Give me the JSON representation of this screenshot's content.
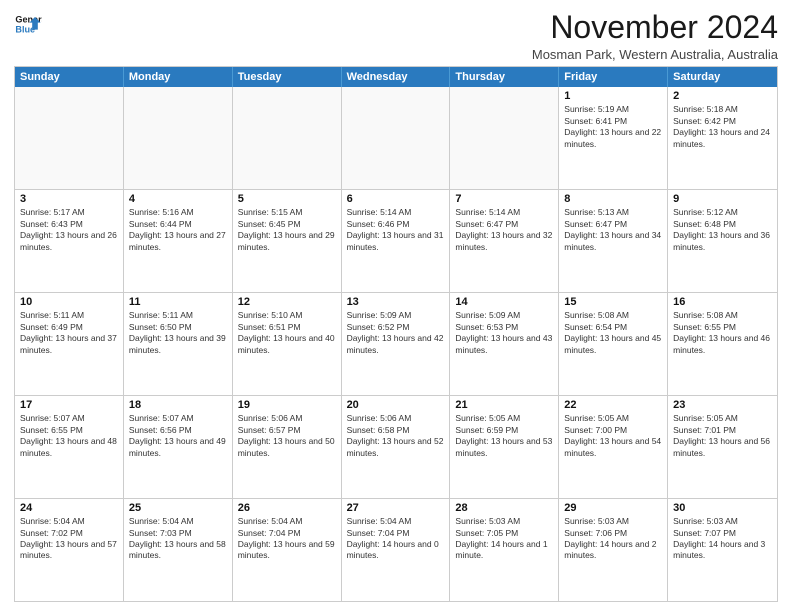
{
  "header": {
    "logo_line1": "General",
    "logo_line2": "Blue",
    "month_title": "November 2024",
    "subtitle": "Mosman Park, Western Australia, Australia"
  },
  "weekdays": [
    "Sunday",
    "Monday",
    "Tuesday",
    "Wednesday",
    "Thursday",
    "Friday",
    "Saturday"
  ],
  "rows": [
    [
      {
        "day": "",
        "empty": true
      },
      {
        "day": "",
        "empty": true
      },
      {
        "day": "",
        "empty": true
      },
      {
        "day": "",
        "empty": true
      },
      {
        "day": "",
        "empty": true
      },
      {
        "day": "1",
        "sunrise": "5:19 AM",
        "sunset": "6:41 PM",
        "daylight": "13 hours and 22 minutes."
      },
      {
        "day": "2",
        "sunrise": "5:18 AM",
        "sunset": "6:42 PM",
        "daylight": "13 hours and 24 minutes."
      }
    ],
    [
      {
        "day": "3",
        "sunrise": "5:17 AM",
        "sunset": "6:43 PM",
        "daylight": "13 hours and 26 minutes."
      },
      {
        "day": "4",
        "sunrise": "5:16 AM",
        "sunset": "6:44 PM",
        "daylight": "13 hours and 27 minutes."
      },
      {
        "day": "5",
        "sunrise": "5:15 AM",
        "sunset": "6:45 PM",
        "daylight": "13 hours and 29 minutes."
      },
      {
        "day": "6",
        "sunrise": "5:14 AM",
        "sunset": "6:46 PM",
        "daylight": "13 hours and 31 minutes."
      },
      {
        "day": "7",
        "sunrise": "5:14 AM",
        "sunset": "6:47 PM",
        "daylight": "13 hours and 32 minutes."
      },
      {
        "day": "8",
        "sunrise": "5:13 AM",
        "sunset": "6:47 PM",
        "daylight": "13 hours and 34 minutes."
      },
      {
        "day": "9",
        "sunrise": "5:12 AM",
        "sunset": "6:48 PM",
        "daylight": "13 hours and 36 minutes."
      }
    ],
    [
      {
        "day": "10",
        "sunrise": "5:11 AM",
        "sunset": "6:49 PM",
        "daylight": "13 hours and 37 minutes."
      },
      {
        "day": "11",
        "sunrise": "5:11 AM",
        "sunset": "6:50 PM",
        "daylight": "13 hours and 39 minutes."
      },
      {
        "day": "12",
        "sunrise": "5:10 AM",
        "sunset": "6:51 PM",
        "daylight": "13 hours and 40 minutes."
      },
      {
        "day": "13",
        "sunrise": "5:09 AM",
        "sunset": "6:52 PM",
        "daylight": "13 hours and 42 minutes."
      },
      {
        "day": "14",
        "sunrise": "5:09 AM",
        "sunset": "6:53 PM",
        "daylight": "13 hours and 43 minutes."
      },
      {
        "day": "15",
        "sunrise": "5:08 AM",
        "sunset": "6:54 PM",
        "daylight": "13 hours and 45 minutes."
      },
      {
        "day": "16",
        "sunrise": "5:08 AM",
        "sunset": "6:55 PM",
        "daylight": "13 hours and 46 minutes."
      }
    ],
    [
      {
        "day": "17",
        "sunrise": "5:07 AM",
        "sunset": "6:55 PM",
        "daylight": "13 hours and 48 minutes."
      },
      {
        "day": "18",
        "sunrise": "5:07 AM",
        "sunset": "6:56 PM",
        "daylight": "13 hours and 49 minutes."
      },
      {
        "day": "19",
        "sunrise": "5:06 AM",
        "sunset": "6:57 PM",
        "daylight": "13 hours and 50 minutes."
      },
      {
        "day": "20",
        "sunrise": "5:06 AM",
        "sunset": "6:58 PM",
        "daylight": "13 hours and 52 minutes."
      },
      {
        "day": "21",
        "sunrise": "5:05 AM",
        "sunset": "6:59 PM",
        "daylight": "13 hours and 53 minutes."
      },
      {
        "day": "22",
        "sunrise": "5:05 AM",
        "sunset": "7:00 PM",
        "daylight": "13 hours and 54 minutes."
      },
      {
        "day": "23",
        "sunrise": "5:05 AM",
        "sunset": "7:01 PM",
        "daylight": "13 hours and 56 minutes."
      }
    ],
    [
      {
        "day": "24",
        "sunrise": "5:04 AM",
        "sunset": "7:02 PM",
        "daylight": "13 hours and 57 minutes."
      },
      {
        "day": "25",
        "sunrise": "5:04 AM",
        "sunset": "7:03 PM",
        "daylight": "13 hours and 58 minutes."
      },
      {
        "day": "26",
        "sunrise": "5:04 AM",
        "sunset": "7:04 PM",
        "daylight": "13 hours and 59 minutes."
      },
      {
        "day": "27",
        "sunrise": "5:04 AM",
        "sunset": "7:04 PM",
        "daylight": "14 hours and 0 minutes."
      },
      {
        "day": "28",
        "sunrise": "5:03 AM",
        "sunset": "7:05 PM",
        "daylight": "14 hours and 1 minute."
      },
      {
        "day": "29",
        "sunrise": "5:03 AM",
        "sunset": "7:06 PM",
        "daylight": "14 hours and 2 minutes."
      },
      {
        "day": "30",
        "sunrise": "5:03 AM",
        "sunset": "7:07 PM",
        "daylight": "14 hours and 3 minutes."
      }
    ]
  ]
}
